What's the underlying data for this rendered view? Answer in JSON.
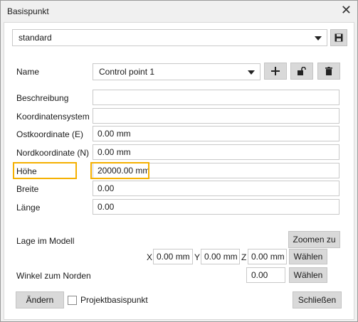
{
  "window": {
    "title": "Basispunkt",
    "close_glyph": "✕"
  },
  "preset": {
    "value": "standard",
    "save_icon": "floppy-disk-icon"
  },
  "name_row": {
    "label": "Name",
    "value": "Control point 1",
    "add_icon": "plus-icon",
    "lock_icon": "unlock-icon",
    "delete_icon": "trash-icon"
  },
  "fields": [
    {
      "label": "Beschreibung",
      "value": ""
    },
    {
      "label": "Koordinatensystem",
      "value": ""
    },
    {
      "label": "Ostkoordinate  (E)",
      "value": "0.00 mm"
    },
    {
      "label": "Nordkoordinate  (N)",
      "value": "0.00 mm"
    },
    {
      "label": "Höhe",
      "value": "20000.00 mm"
    },
    {
      "label": "Breite",
      "value": "0.00"
    },
    {
      "label": "Länge",
      "value": "0.00"
    }
  ],
  "highlight_color": "#f5b000",
  "model": {
    "label": "Lage im Modell",
    "zoom_button": "Zoomen zu",
    "x_label": "X",
    "x_value": "0.00 mm",
    "y_label": "Y",
    "y_value": "0.00 mm",
    "z_label": "Z",
    "z_value": "0.00 mm",
    "select_button": "Wählen"
  },
  "north": {
    "label": "Winkel zum Norden",
    "value": "0.00",
    "select_button": "Wählen"
  },
  "footer": {
    "change_button": "Ändern",
    "checkbox_label": "Projektbasispunkt",
    "close_button": "Schließen"
  }
}
